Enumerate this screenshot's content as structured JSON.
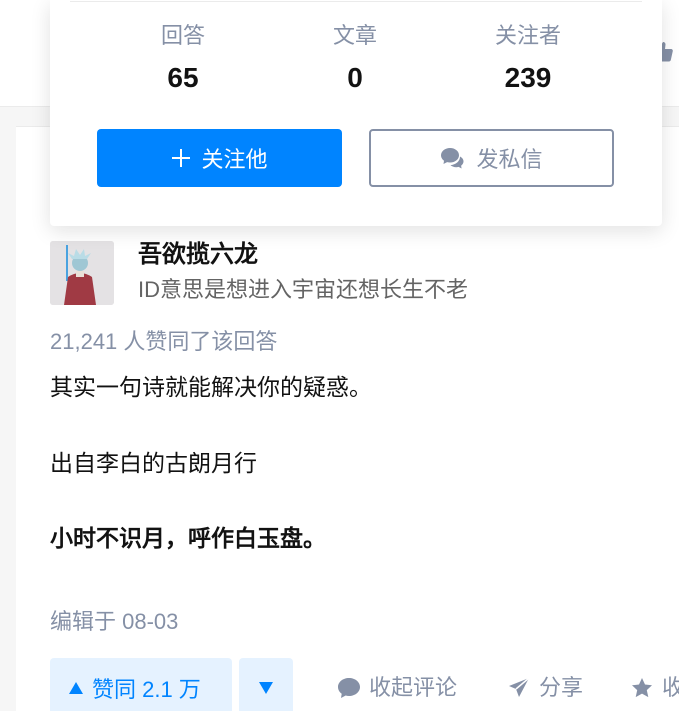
{
  "profile_card": {
    "stats": [
      {
        "label": "回答",
        "value": "65"
      },
      {
        "label": "文章",
        "value": "0"
      },
      {
        "label": "关注者",
        "value": "239"
      }
    ],
    "follow_label": "关注他",
    "message_label": "发私信"
  },
  "author": {
    "name": "吾欲揽六龙",
    "bio": "ID意思是想进入宇宙还想长生不老"
  },
  "answer": {
    "votes_text": "21,241 人赞同了该回答",
    "paragraphs": [
      "其实一句诗就能解决你的疑惑。",
      "出自李白的古朗月行",
      "小时不识月，呼作白玉盘。"
    ],
    "edited_text": "编辑于 08-03"
  },
  "actions": {
    "vote_up_label": "赞同 2.1 万",
    "comment_label": "收起评论",
    "share_label": "分享",
    "collect_label": "收藏"
  },
  "colors": {
    "primary": "#0084ff",
    "secondary_text": "#8590a6",
    "vote_bg": "#e5f2ff"
  }
}
